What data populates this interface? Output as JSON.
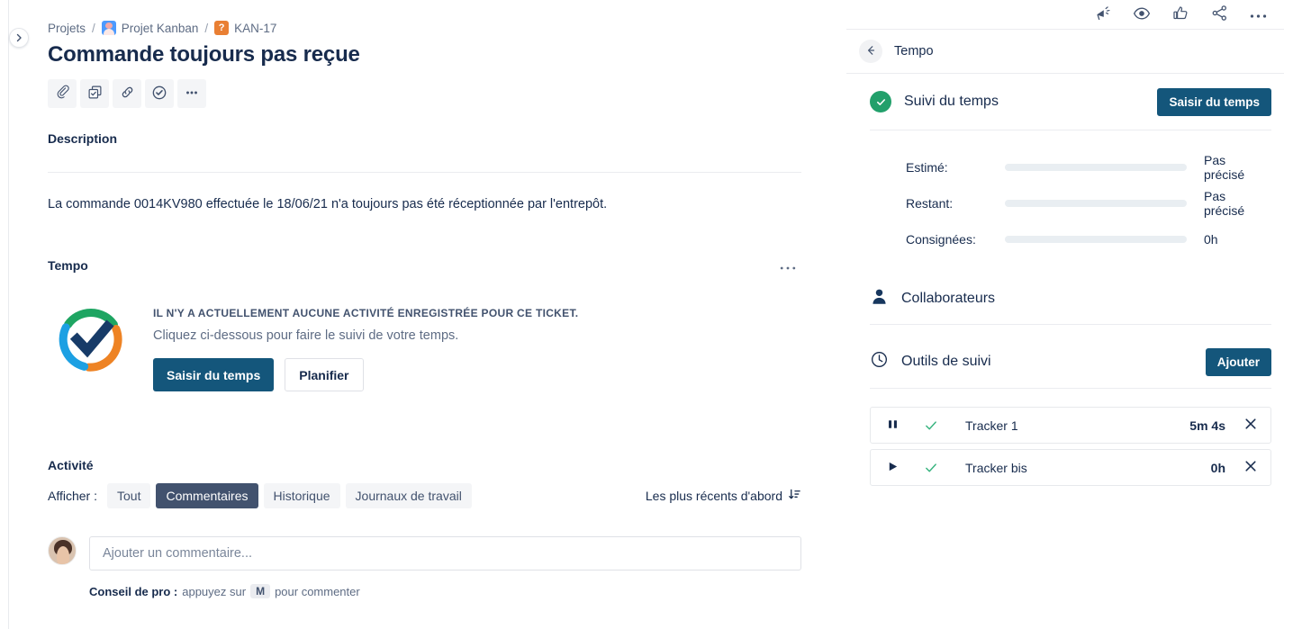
{
  "breadcrumb": {
    "root": "Projets",
    "separator": "/",
    "project": "Projet Kanban",
    "project_icon": "project-avatar-icon",
    "issue_key": "KAN-17",
    "issue_type_icon": "question-type-icon",
    "issue_type_glyph": "?"
  },
  "issue": {
    "title": "Commande toujours pas reçue",
    "actions": [
      {
        "name": "attach-icon",
        "label": "Joindre"
      },
      {
        "name": "child-issue-icon",
        "label": "Ajouter un élément enfant"
      },
      {
        "name": "link-icon",
        "label": "Lier"
      },
      {
        "name": "check-circle-icon",
        "label": "Appliquer"
      },
      {
        "name": "more-icon",
        "label": "Plus"
      }
    ]
  },
  "description": {
    "label": "Description",
    "text": "La commande 0014KV980 effectuée le 18/06/21 n'a toujours pas été réceptionnée par l'entrepôt."
  },
  "tempo_panel": {
    "label": "Tempo",
    "more_icon": "ellipsis-icon",
    "logo_icon": "tempo-logo-icon",
    "empty_headline": "IL N'Y A ACTUELLEMENT AUCUNE ACTIVITÉ ENREGISTRÉE POUR CE TICKET.",
    "empty_sub": "Cliquez ci-dessous pour faire le suivi de votre temps.",
    "primary_button": "Saisir du temps",
    "secondary_button": "Planifier",
    "logo_colors": {
      "green": "#1EA562",
      "orange": "#EE8324",
      "blue": "#1CA0E3",
      "check": "#173B68"
    }
  },
  "activity": {
    "label": "Activité",
    "filter_label": "Afficher :",
    "filters": [
      {
        "label": "Tout",
        "active": false
      },
      {
        "label": "Commentaires",
        "active": true
      },
      {
        "label": "Historique",
        "active": false
      },
      {
        "label": "Journaux de travail",
        "active": false
      }
    ],
    "sort": {
      "label": "Les plus récents d'abord",
      "icon": "sort-descending-icon"
    },
    "comment": {
      "avatar_icon": "user-avatar",
      "placeholder": "Ajouter un commentaire...",
      "value": "",
      "tip_prefix": "Conseil de pro :",
      "tip_text_before": "appuyez sur",
      "tip_key": "M",
      "tip_text_after": "pour commenter"
    }
  },
  "right_panel": {
    "top_icons": [
      {
        "name": "megaphone-icon",
        "label": "Donner votre avis"
      },
      {
        "name": "eye-icon",
        "label": "Suivre"
      },
      {
        "name": "thumbs-up-icon",
        "label": "J'aime"
      },
      {
        "name": "share-icon",
        "label": "Partager"
      },
      {
        "name": "more-icon",
        "label": "Plus"
      }
    ],
    "back_icon": "arrow-left-icon",
    "header_title": "Tempo",
    "time_tracking": {
      "icon": "green-check-icon",
      "title": "Suivi du temps",
      "button": "Saisir du temps",
      "rows": [
        {
          "label": "Estimé:",
          "value": "Pas précisé"
        },
        {
          "label": "Restant:",
          "value": "Pas précisé"
        },
        {
          "label": "Consignées:",
          "value": "0h"
        }
      ]
    },
    "collaborators": {
      "icon": "person-icon",
      "title": "Collaborateurs"
    },
    "tracking_tools": {
      "icon": "clock-icon",
      "title": "Outils de suivi",
      "button": "Ajouter",
      "trackers": [
        {
          "state_icon": "pause-icon",
          "confirm_icon": "check-icon",
          "name": "Tracker 1",
          "time": "5m 4s",
          "close_icon": "close-icon"
        },
        {
          "state_icon": "play-icon",
          "confirm_icon": "check-icon",
          "name": "Tracker bis",
          "time": "0h",
          "close_icon": "close-icon"
        }
      ]
    }
  },
  "sidebar": {
    "expand_icon": "chevron-right-icon"
  },
  "colors": {
    "brand_navy": "#14567B",
    "green": "#22A06B",
    "orange": "#E97F33",
    "text": "#172B4D"
  }
}
